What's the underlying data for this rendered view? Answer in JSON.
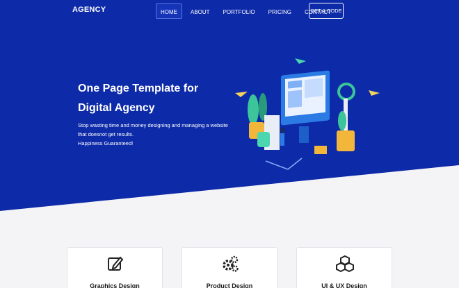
{
  "nav": {
    "brand": "AGENCY",
    "links": [
      "HOME",
      "ABOUT",
      "PORTFOLIO",
      "PRICING",
      "CONTACT"
    ],
    "cta": "GET A CODE"
  },
  "hero": {
    "title_line1": "One Page Template for",
    "title_line2": "Digital Agency",
    "sub_line1": "Stop wasting time and money designing and managing a website",
    "sub_line2": "that doesnot get results.",
    "sub_line3": "Happiness Guaranteed!"
  },
  "services": [
    {
      "title": "Graphics Design",
      "icon": "edit-icon"
    },
    {
      "title": "Product Design",
      "icon": "gears-icon"
    },
    {
      "title": "UI & UX Design",
      "icon": "cubes-icon"
    }
  ],
  "colors": {
    "hero_bg": "#0d2aa8",
    "page_bg": "#f4f4f6"
  }
}
